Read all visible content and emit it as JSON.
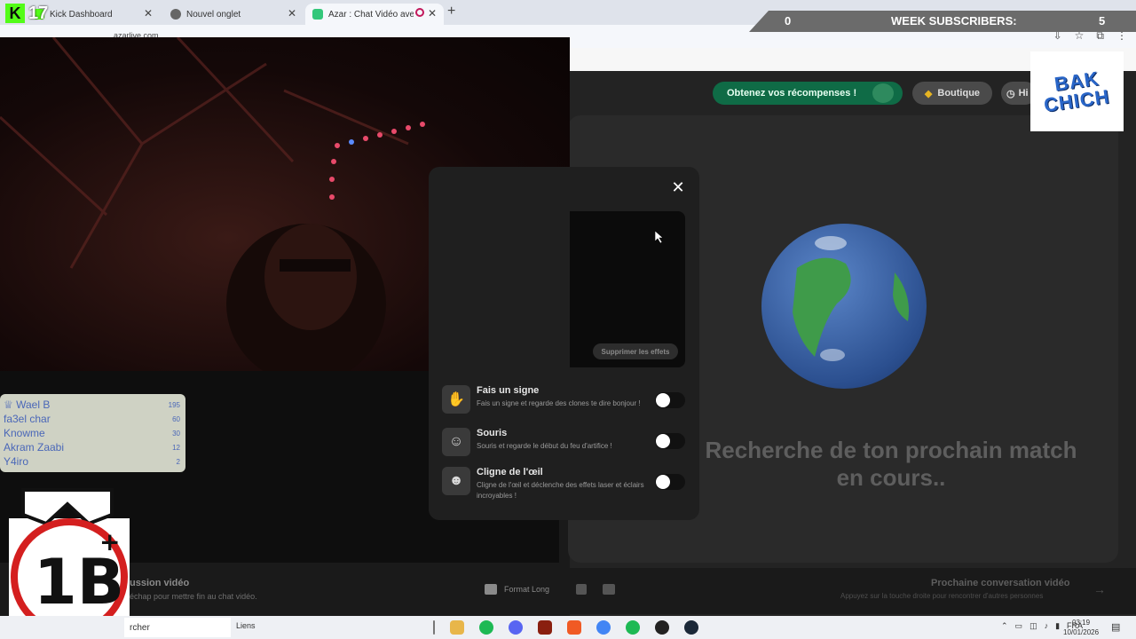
{
  "kick": {
    "number": "17"
  },
  "tabs": [
    {
      "label": "Kick Dashboard",
      "favicon_color": "#53fc18"
    },
    {
      "label": "Nouvel onglet",
      "favicon_color": "#666666"
    },
    {
      "label": "Azar : Chat Vidéo avec de",
      "favicon_color": "#33c77a"
    }
  ],
  "subscribers": {
    "left_value": "0",
    "title": "WEEK SUBSCRIBERS:",
    "right_value": "5"
  },
  "page_url": "azarlive.com",
  "topnav": {
    "reward_label": "Obtenez vos récompenses !",
    "boutique_label": "Boutique",
    "history_label": "Hi"
  },
  "brand": {
    "line1": "BAK",
    "line2": "CHICH"
  },
  "match": {
    "text": "Recherche de ton prochain match en cours.."
  },
  "modal": {
    "remove_effects_label": "Supprimer les effets",
    "effects": [
      {
        "title": "Fais un signe",
        "description": "Fais un signe et regarde des clones te dire bonjour !",
        "icon": "wave-hand-icon",
        "enabled": false
      },
      {
        "title": "Souris",
        "description": "Souris et regarde le début du feu d'artifice !",
        "icon": "smile-icon",
        "enabled": false
      },
      {
        "title": "Cligne de l'œil",
        "description": "Cligne de l'œil et déclenche des effets laser et éclairs incroyables !",
        "icon": "wink-icon",
        "enabled": false
      }
    ]
  },
  "bottom": {
    "left_title": "ussion vidéo",
    "left_sub": "échap pour mettre fin au chat vidéo.",
    "format_label": "Format Long",
    "next_title": "Prochaine conversation vidéo",
    "next_sub": "Appuyez sur la touche droite pour rencontrer d'autres personnes"
  },
  "leaderboard": [
    {
      "name": "Wael B",
      "score": "195"
    },
    {
      "name": "fa3el char",
      "score": "60"
    },
    {
      "name": "Knowme",
      "score": "30"
    },
    {
      "name": "Akram Zaabi",
      "score": "12"
    },
    {
      "name": "Y4iro",
      "score": "2"
    }
  ],
  "taskbar": {
    "search_text": "rcher",
    "liens_label": "Liens",
    "lang": "FRA",
    "time": "03:19",
    "date": "10/01/2026"
  },
  "colors": {
    "accent_green": "#0f6b46",
    "kick_green": "#53fc18",
    "leaderboard_text": "#4a67b8",
    "brand_blue": "#2a66c8"
  }
}
